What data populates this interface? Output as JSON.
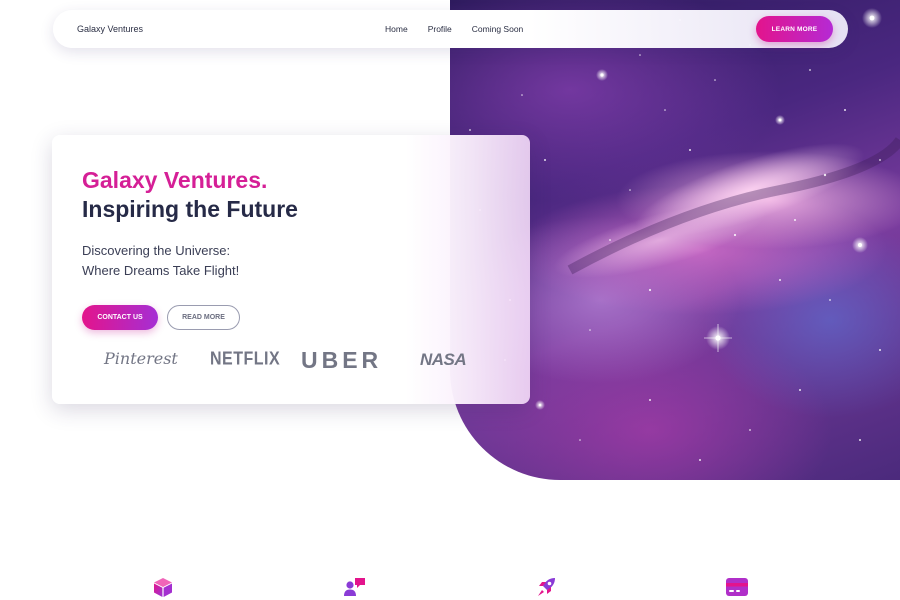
{
  "navbar": {
    "brand": "Galaxy Ventures",
    "links": [
      "Home",
      "Profile",
      "Coming Soon"
    ],
    "cta_label": "LEARN MORE"
  },
  "hero": {
    "title_line1": "Galaxy Ventures.",
    "title_line2": "Inspiring the Future",
    "subtitle_line1": "Discovering the Universe:",
    "subtitle_line2": "Where Dreams Take Flight!",
    "primary_button": "CONTACT US",
    "secondary_button": "READ MORE"
  },
  "partner_logos": [
    "Pinterest",
    "NETFLIX",
    "UBER",
    "NASA"
  ],
  "features": {
    "icons": [
      "cube-icon",
      "user-chat-icon",
      "rocket-icon",
      "credit-card-icon"
    ]
  },
  "colors": {
    "accent_pink": "#d51f96",
    "accent_purple": "#8a3bd6",
    "dark_text": "#262a47"
  }
}
